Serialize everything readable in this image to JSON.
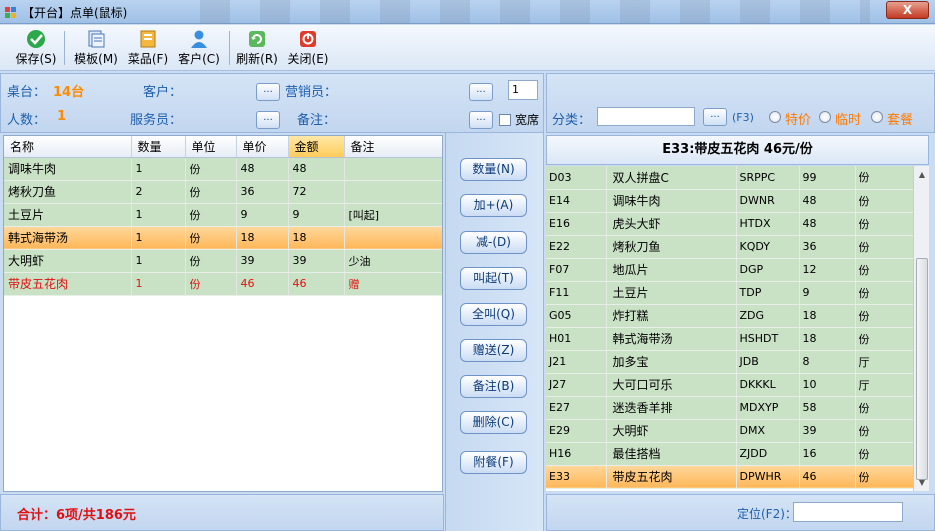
{
  "window": {
    "title": "【开台】点单(鼠标)",
    "close_label": "X"
  },
  "toolbar": {
    "items": [
      {
        "label": "保存(S)",
        "icon": "check-icon"
      },
      {
        "label": "模板(M)",
        "icon": "template-icon"
      },
      {
        "label": "菜品(F)",
        "icon": "dish-icon"
      },
      {
        "label": "客户(C)",
        "icon": "customer-icon"
      },
      {
        "label": "刷新(R)",
        "icon": "refresh-icon"
      },
      {
        "label": "关闭(E)",
        "icon": "close-icon"
      }
    ]
  },
  "info": {
    "table_label": "桌台：",
    "table_value": "14台",
    "customer_label": "客户：",
    "sales_label": "营销员：",
    "people_label": "人数：",
    "people_value": "1",
    "waiter_label": "服务员：",
    "note_label": "备注：",
    "count_value": "1",
    "wide_label": "宽席",
    "dots": "...",
    "category_label": "分类：",
    "category_hotkey": "(F3)",
    "radio_special": "特价",
    "radio_temp": "临时",
    "radio_set": "套餐"
  },
  "order_grid": {
    "headers": [
      "名称",
      "数量",
      "单位",
      "单价",
      "金额",
      "备注"
    ],
    "rows": [
      {
        "name": "调味牛肉",
        "qty": "1",
        "unit": "份",
        "price": "48",
        "amount": "48",
        "note": ""
      },
      {
        "name": "烤秋刀鱼",
        "qty": "2",
        "unit": "份",
        "price": "36",
        "amount": "72",
        "note": ""
      },
      {
        "name": "土豆片",
        "qty": "1",
        "unit": "份",
        "price": "9",
        "amount": "9",
        "note": "[叫起]"
      },
      {
        "name": "韩式海带汤",
        "qty": "1",
        "unit": "份",
        "price": "18",
        "amount": "18",
        "note": ""
      },
      {
        "name": "大明虾",
        "qty": "1",
        "unit": "份",
        "price": "39",
        "amount": "39",
        "note": "少油"
      },
      {
        "name": "带皮五花肉",
        "qty": "1",
        "unit": "份",
        "price": "46",
        "amount": "46",
        "note": "赠"
      }
    ]
  },
  "actions": [
    "数量(N)",
    "加+(A)",
    "减-(D)",
    "叫起(T)",
    "全叫(Q)",
    "赠送(Z)",
    "备注(B)",
    "删除(C)",
    "附餐(F)"
  ],
  "summary": "合计：6项/共186元",
  "detail": {
    "header": "E33:带皮五花肉  46元/份",
    "rows": [
      {
        "code": "D03",
        "name": "双人拼盘C",
        "abbr": "SRPPC",
        "price": "99",
        "unit": "份"
      },
      {
        "code": "E14",
        "name": "调味牛肉",
        "abbr": "DWNR",
        "price": "48",
        "unit": "份"
      },
      {
        "code": "E16",
        "name": "虎头大虾",
        "abbr": "HTDX",
        "price": "48",
        "unit": "份"
      },
      {
        "code": "E22",
        "name": "烤秋刀鱼",
        "abbr": "KQDY",
        "price": "36",
        "unit": "份"
      },
      {
        "code": "F07",
        "name": "地瓜片",
        "abbr": "DGP",
        "price": "12",
        "unit": "份"
      },
      {
        "code": "F11",
        "name": "土豆片",
        "abbr": "TDP",
        "price": "9",
        "unit": "份"
      },
      {
        "code": "G05",
        "name": "炸打糕",
        "abbr": "ZDG",
        "price": "18",
        "unit": "份"
      },
      {
        "code": "H01",
        "name": "韩式海带汤",
        "abbr": "HSHDT",
        "price": "18",
        "unit": "份"
      },
      {
        "code": "J21",
        "name": "加多宝",
        "abbr": "JDB",
        "price": "8",
        "unit": "厅"
      },
      {
        "code": "J27",
        "name": "大可口可乐",
        "abbr": "DKKKL",
        "price": "10",
        "unit": "厅"
      },
      {
        "code": "E27",
        "name": "迷迭香羊排",
        "abbr": "MDXYP",
        "price": "58",
        "unit": "份"
      },
      {
        "code": "E29",
        "name": "大明虾",
        "abbr": "DMX",
        "price": "39",
        "unit": "份"
      },
      {
        "code": "H16",
        "name": "最佳搭档",
        "abbr": "ZJDD",
        "price": "16",
        "unit": "份"
      },
      {
        "code": "E33",
        "name": "带皮五花肉",
        "abbr": "DPWHR",
        "price": "46",
        "unit": "份"
      }
    ]
  },
  "locate_label": "定位(F2)："
}
